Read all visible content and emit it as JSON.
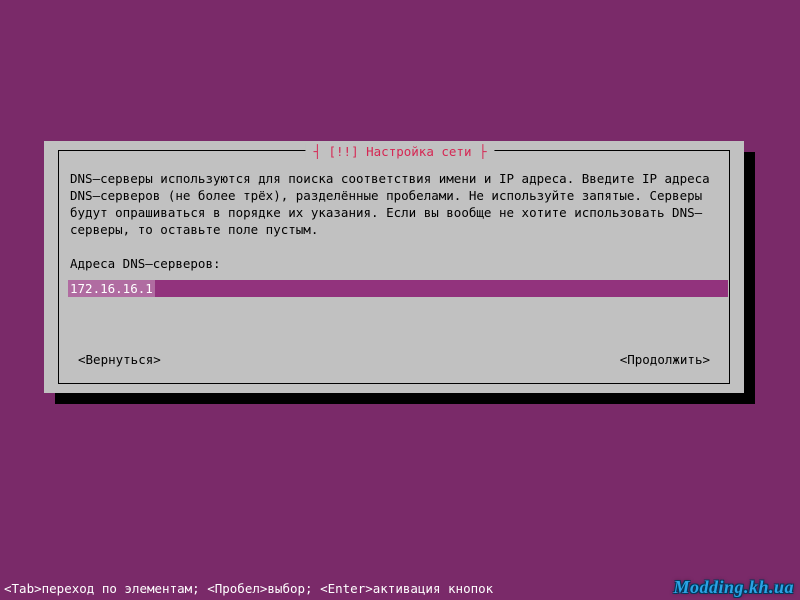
{
  "colors": {
    "background": "#7a2a69",
    "panel": "#c1c1c1",
    "input_bg": "#92337d",
    "input_value_bg": "#b06ca1",
    "title_accent": "#d52753"
  },
  "dialog": {
    "title": "[!!] Настройка сети",
    "description": "DNS–серверы используются для поиска соответствия имени и IP адреса. Введите IP адреса DNS–серверов (не более трёх), разделённые пробелами. Не используйте запятые. Серверы будут опрашиваться в порядке их указания. Если вы вообще не хотите использовать DNS–серверы, то оставьте поле пустым.",
    "prompt": "Адреса DNS–серверов:",
    "input_value": "172.16.16.1",
    "back_label": "<Вернуться>",
    "continue_label": "<Продолжить>"
  },
  "helpbar": "<Tab>переход по элементам; <Пробел>выбор; <Enter>активация кнопок",
  "watermark": "Modding.kh.ua"
}
